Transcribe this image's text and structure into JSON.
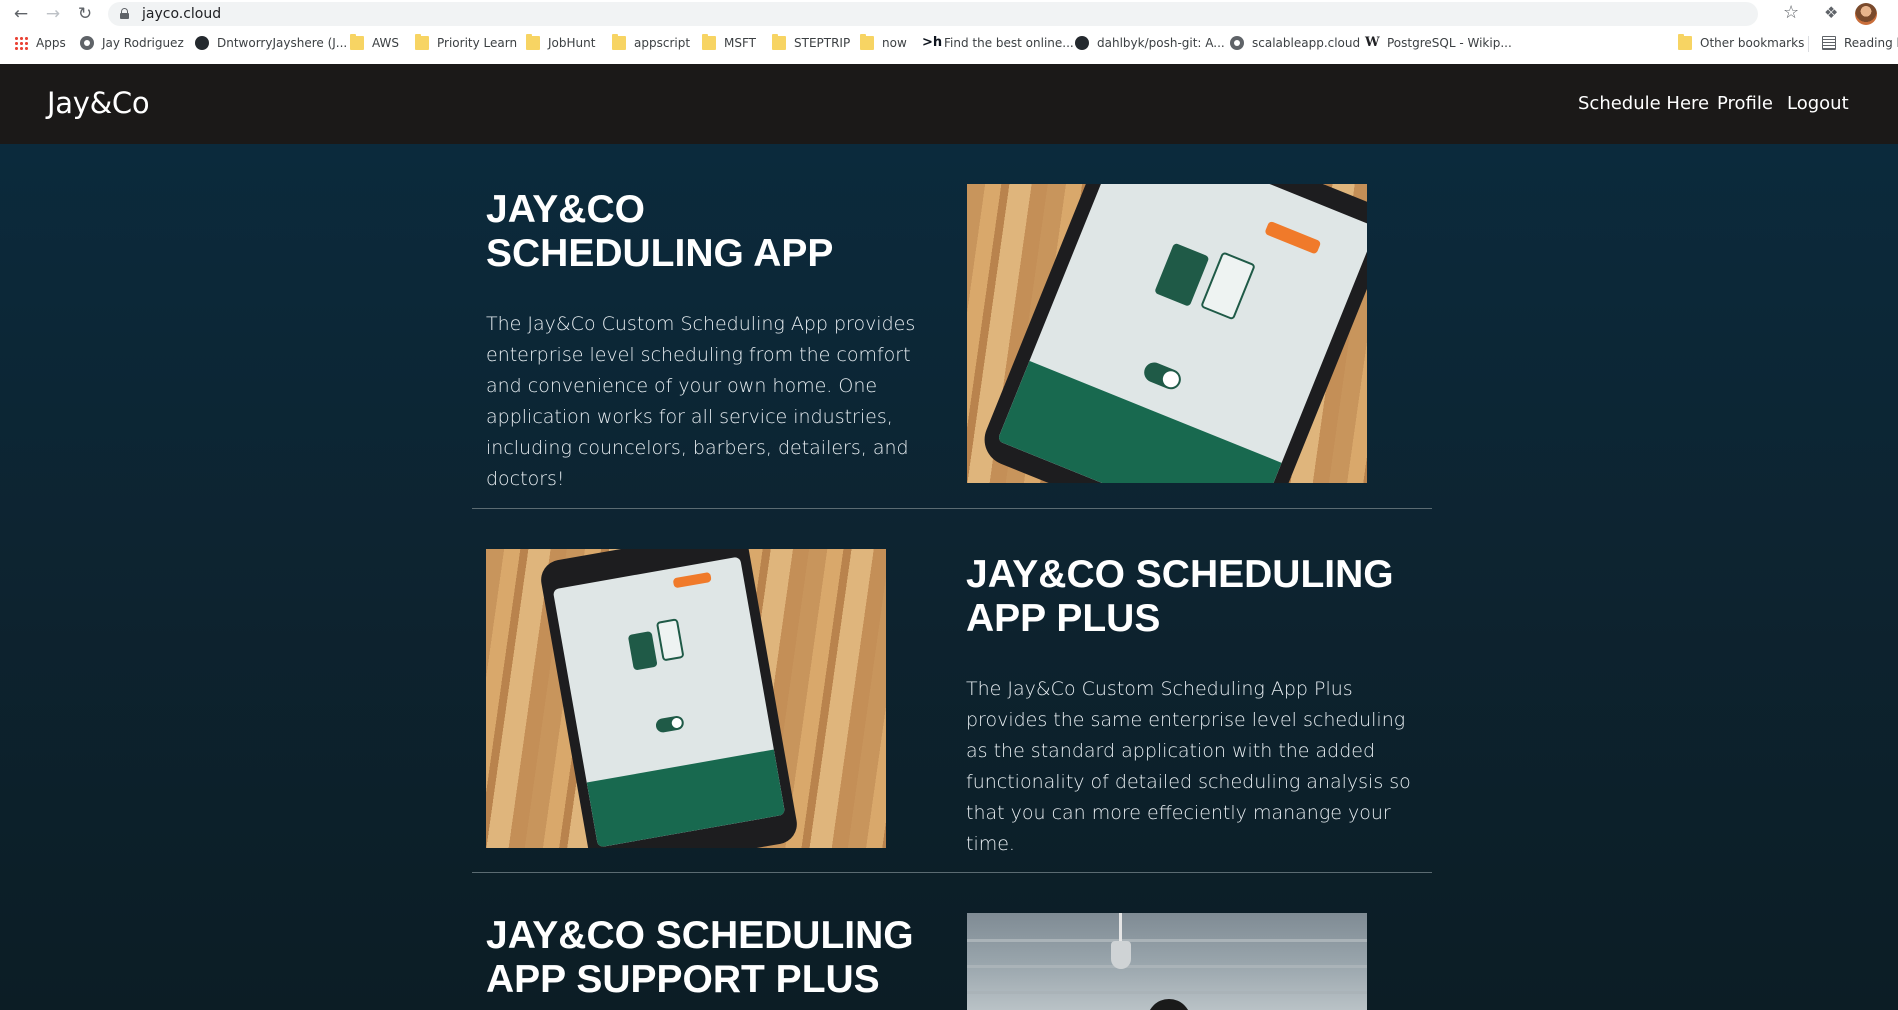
{
  "browser": {
    "url": "jayco.cloud",
    "bookmarks": [
      {
        "label": "Apps",
        "icon": "apps-grid-icon"
      },
      {
        "label": "Jay Rodriguez",
        "icon": "globe-icon"
      },
      {
        "label": "DntworryJayshere (J...",
        "icon": "github-icon"
      },
      {
        "label": "AWS",
        "icon": "folder-icon"
      },
      {
        "label": "Priority Learn",
        "icon": "folder-icon"
      },
      {
        "label": "JobHunt",
        "icon": "folder-icon"
      },
      {
        "label": "appscript",
        "icon": "folder-icon"
      },
      {
        "label": "MSFT",
        "icon": "folder-icon"
      },
      {
        "label": "STEPTRIP",
        "icon": "folder-icon"
      },
      {
        "label": "now",
        "icon": "folder-icon"
      },
      {
        "label": "Find the best online...",
        "icon": "hackerrank-icon"
      },
      {
        "label": "dahlbyk/posh-git: A...",
        "icon": "github-icon"
      },
      {
        "label": "scalableapp.cloud",
        "icon": "globe-icon"
      },
      {
        "label": "PostgreSQL - Wikip...",
        "icon": "wikipedia-icon"
      },
      {
        "label": "Other bookmarks",
        "icon": "folder-icon"
      },
      {
        "label": "Reading li",
        "icon": "reading-list-icon"
      }
    ]
  },
  "site": {
    "brand": "Jay&Co",
    "nav": {
      "schedule": "Schedule Here",
      "profile": "Profile",
      "logout": "Logout"
    }
  },
  "sections": [
    {
      "title": "JAY&CO SCHEDULING APP",
      "text": "The Jay&Co Custom Scheduling App provides enterprise level scheduling from the comfort and convenience of your own home. One application works for all service industries, including councelors, barbers, detailers, and doctors!"
    },
    {
      "title": "JAY&CO SCHEDULING APP PLUS",
      "text": "The Jay&Co Custom Scheduling App Plus provides the same enterprise level scheduling as the standard application with the added functionality of detailed scheduling analysis so that you can more effeciently manange your time."
    },
    {
      "title": "JAY&CO SCHEDULING APP SUPPORT PLUS",
      "text": ""
    }
  ],
  "colors": {
    "navbar": "#1b1918",
    "page_background": "#0b2a3c",
    "text": "#ffffff"
  }
}
